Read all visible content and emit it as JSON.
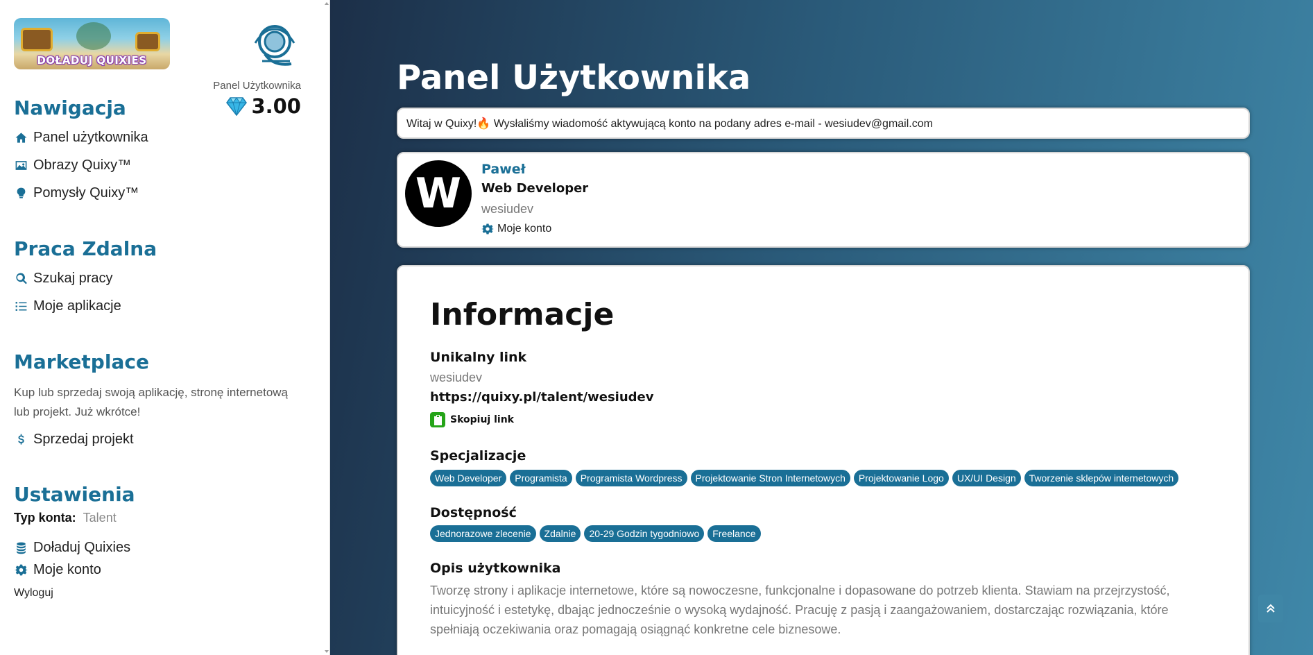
{
  "sidebar": {
    "banner_text": "DOŁADUJ QUIXIES",
    "panel_label": "Panel Użytkownika",
    "balance": "3.00",
    "nav_title": "Nawigacja",
    "nav_items": [
      {
        "label": "Panel użytkownika",
        "icon": "home-icon"
      },
      {
        "label": "Obrazy Quixy™",
        "icon": "image-icon"
      },
      {
        "label": "Pomysły Quixy™",
        "icon": "lightbulb-icon"
      }
    ],
    "remote_title": "Praca Zdalna",
    "remote_items": [
      {
        "label": "Szukaj pracy",
        "icon": "search-icon"
      },
      {
        "label": "Moje aplikacje",
        "icon": "list-icon"
      }
    ],
    "market_title": "Marketplace",
    "market_desc": "Kup lub sprzedaj swoją aplikację, stronę internetową lub projekt. Już wkrótce!",
    "market_items": [
      {
        "label": "Sprzedaj projekt",
        "icon": "dollar-icon"
      }
    ],
    "settings_title": "Ustawienia",
    "account_type_label": "Typ konta:",
    "account_type_value": "Talent",
    "settings_items": [
      {
        "label": "Doładuj Quixies",
        "icon": "coins-icon"
      },
      {
        "label": "Moje konto",
        "icon": "gear-icon"
      }
    ],
    "logout": "Wyloguj"
  },
  "main": {
    "title": "Panel Użytkownika",
    "welcome": "Witaj w Quixy!🔥 Wysłaliśmy wiadomość aktywującą konto na podany adres e-mail - wesiudev@gmail.com",
    "profile": {
      "avatar_letter": "W",
      "name": "Paweł",
      "role": "Web Developer",
      "username": "wesiudev",
      "account_link": "Moje konto"
    },
    "info": {
      "title": "Informacje",
      "unique_link_label": "Unikalny link",
      "unique_link_user": "wesiudev",
      "unique_link_url": "https://quixy.pl/talent/wesiudev",
      "copy_label": "Skopiuj link",
      "specializations_label": "Specjalizacje",
      "specializations": [
        "Web Developer",
        "Programista",
        "Programista Wordpress",
        "Projektowanie Stron Internetowych",
        "Projektowanie Logo",
        "UX/UI Design",
        "Tworzenie sklepów internetowych"
      ],
      "availability_label": "Dostępność",
      "availability": [
        "Jednorazowe zlecenie",
        "Zdalnie",
        "20-29 Godzin tygodniowo",
        "Freelance"
      ],
      "description_label": "Opis użytkownika",
      "description": "Tworzę strony i aplikacje internetowe, które są nowoczesne, funkcjonalne i dopasowane do potrzeb klienta. Stawiam na przejrzystość, intuicyjność i estetykę, dbając jednocześnie o wysoką wydajność. Pracuję z pasją i zaangażowaniem, dostarczając rozwiązania, które spełniają oczekiwania oraz pomagają osiągnąć konkretne cele biznesowe."
    }
  },
  "colors": {
    "accent": "#1a6f96",
    "copy_button": "#25a418",
    "gradient_start": "#1c2f48",
    "gradient_end": "#3f87a8"
  }
}
